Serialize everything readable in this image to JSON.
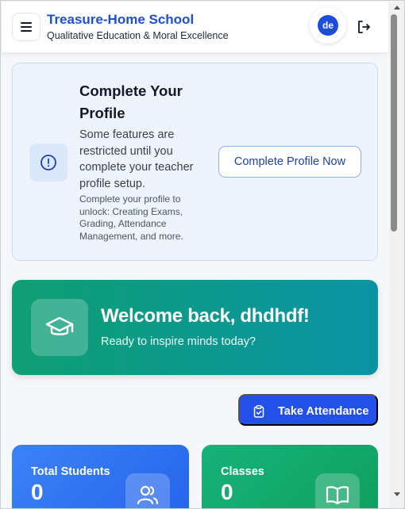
{
  "header": {
    "title": "Treasure-Home School",
    "subtitle": "Qualitative Education & Moral Excellence",
    "avatar_initials": "de",
    "menu_icon": "hamburger-icon",
    "logout_icon": "logout-icon"
  },
  "profile_alert": {
    "title": "Complete Your Profile",
    "description": "Some features are restricted until you complete your teacher profile setup.",
    "note": "Complete your profile to unlock: Creating Exams, Grading, Attendance Management, and more.",
    "button_label": "Complete Profile Now",
    "icon": "alert-circle-icon"
  },
  "welcome": {
    "title": "Welcome back, dhdhdf!",
    "subtitle": "Ready to inspire minds today?",
    "icon": "graduation-cap-icon"
  },
  "actions": {
    "attendance_label": "Take Attendance",
    "attendance_icon": "clipboard-check-icon"
  },
  "stats": [
    {
      "label": "Total Students",
      "value": "0",
      "icon": "users-icon"
    },
    {
      "label": "Classes",
      "value": "0",
      "icon": "book-open-icon"
    }
  ],
  "colors": {
    "brand": "#1d4ed8",
    "welcome_start": "#0f9f73",
    "welcome_end": "#0b93a5",
    "attendance": "#2250e8",
    "stat_blue": "#3b82f6",
    "stat_green": "#16b27a"
  }
}
